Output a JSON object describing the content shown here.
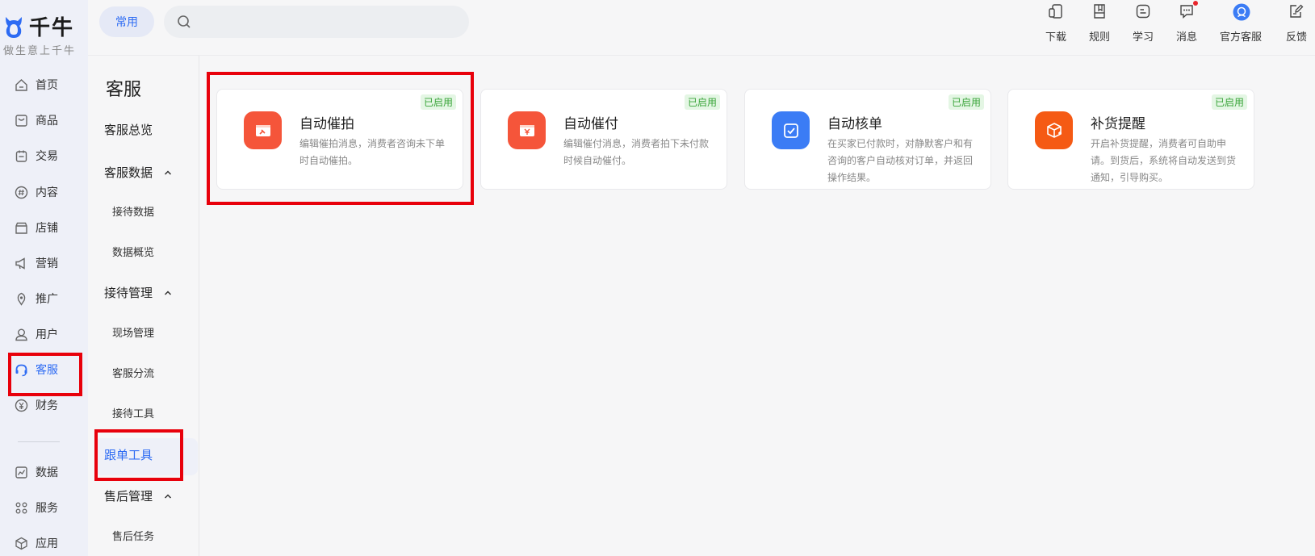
{
  "brand": {
    "name": "千牛",
    "slogan": "做生意上千牛"
  },
  "main_nav": [
    {
      "label": "首页",
      "icon": "home-icon"
    },
    {
      "label": "商品",
      "icon": "goods-icon"
    },
    {
      "label": "交易",
      "icon": "trade-icon"
    },
    {
      "label": "内容",
      "icon": "content-icon"
    },
    {
      "label": "店铺",
      "icon": "shop-icon"
    },
    {
      "label": "营销",
      "icon": "megaphone-icon"
    },
    {
      "label": "推广",
      "icon": "promote-icon"
    },
    {
      "label": "用户",
      "icon": "user-icon"
    },
    {
      "label": "客服",
      "icon": "headset-icon",
      "active": true
    },
    {
      "label": "财务",
      "icon": "yuan-icon"
    },
    {
      "label": "数据",
      "icon": "chart-icon"
    },
    {
      "label": "服务",
      "icon": "grid-icon"
    },
    {
      "label": "应用",
      "icon": "cube-icon"
    }
  ],
  "subnav": {
    "title": "客服",
    "overview": "客服总览",
    "groups": [
      {
        "label": "客服数据",
        "items": [
          "接待数据",
          "数据概览"
        ]
      },
      {
        "label": "接待管理",
        "items": [
          "现场管理",
          "客服分流",
          "接待工具",
          "跟单工具"
        ]
      },
      {
        "label": "售后管理",
        "items": [
          "售后任务"
        ]
      }
    ],
    "active_item": "跟单工具"
  },
  "topbar": {
    "frequent_label": "常用",
    "search": {
      "value": "",
      "placeholder": ""
    },
    "tools": [
      {
        "label": "下载",
        "icon": "download-icon"
      },
      {
        "label": "规则",
        "icon": "rules-icon"
      },
      {
        "label": "学习",
        "icon": "learn-icon"
      },
      {
        "label": "消息",
        "icon": "message-icon",
        "has_dot": true
      },
      {
        "label": "官方客服",
        "icon": "official-service-icon"
      },
      {
        "label": "反馈",
        "icon": "feedback-icon"
      }
    ]
  },
  "cards": [
    {
      "title": "自动催拍",
      "desc": "编辑催拍消息，消费者咨询未下单时自动催拍。",
      "badge": "已启用",
      "icon": "auto-remind-order-icon",
      "color": "#f5553a"
    },
    {
      "title": "自动催付",
      "desc": "编辑催付消息，消费者拍下未付款时候自动催付。",
      "badge": "已启用",
      "icon": "auto-remind-pay-icon",
      "color": "#f5553a"
    },
    {
      "title": "自动核单",
      "desc": "在买家已付款时，对静默客户和有咨询的客户自动核对订单，并返回操作结果。",
      "badge": "已启用",
      "icon": "auto-verify-icon",
      "color": "#3b7cf5"
    },
    {
      "title": "补货提醒",
      "desc": "开启补货提醒，消费者可自助申请。到货后，系统将自动发送到货通知，引导购买。",
      "badge": "已启用",
      "icon": "restock-reminder-icon",
      "color": "#f55a14"
    }
  ],
  "colors": {
    "accent": "#2d6bf3",
    "annotation": "#e8000b",
    "badge_green": "#3aa53a"
  }
}
